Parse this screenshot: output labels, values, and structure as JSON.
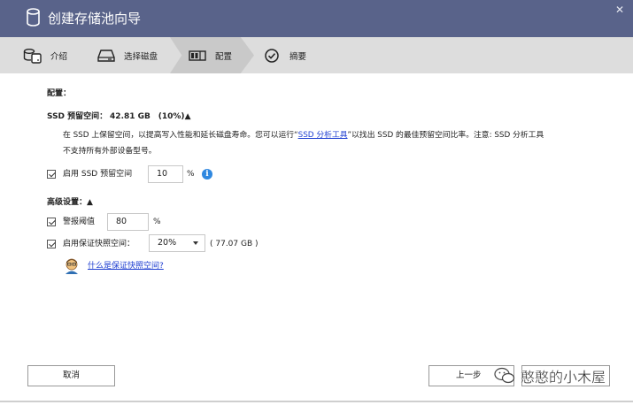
{
  "window": {
    "title": "创建存储池向导",
    "close_symbol": "✕"
  },
  "steps": [
    {
      "label": "介绍",
      "icon": "storage-drives-icon"
    },
    {
      "label": "选择磁盘",
      "icon": "disk-icon"
    },
    {
      "label": "配置",
      "icon": "raid-config-icon",
      "active": true
    },
    {
      "label": "摘要",
      "icon": "checkmark-circle-icon"
    }
  ],
  "config": {
    "heading": "配置：",
    "ssd_reserve_label": "SSD 预留空间：",
    "ssd_reserve_value": "42.81 GB",
    "ssd_reserve_percent": "(10%)",
    "ssd_reserve_toggle": "▲",
    "desc_line1_prefix": "在 SSD 上保留空间，以提高写入性能和延长磁盘寿命。您可以运行“",
    "desc_link": "SSD 分析工具",
    "desc_line1_suffix": "”以找出 SSD 的最佳预留空间比率。注意: SSD 分析工具",
    "desc_line2": "不支持所有外部设备型号。",
    "enable_ssd_label": "启用 SSD 预留空间",
    "enable_ssd_checked": true,
    "ssd_percent_value": "10",
    "percent_unit": "%"
  },
  "advanced": {
    "heading": "高级设置：",
    "toggle": "▲",
    "alert_label": "警报阈值",
    "alert_checked": true,
    "alert_value": "80",
    "alert_unit": "%",
    "snapshot_label": "启用保证快照空间：",
    "snapshot_checked": true,
    "snapshot_selected": "20%",
    "snapshot_size": "( 77.07 GB )",
    "help_link": "什么是保证快照空间?"
  },
  "buttons": {
    "cancel": "取消",
    "back": "上一步"
  },
  "watermark": {
    "text": "憨憨的小木屋"
  },
  "colors": {
    "titlebar": "#59638a",
    "steps_bar": "#dddddd",
    "link": "#1f3fd1",
    "info": "#2f88e0"
  }
}
